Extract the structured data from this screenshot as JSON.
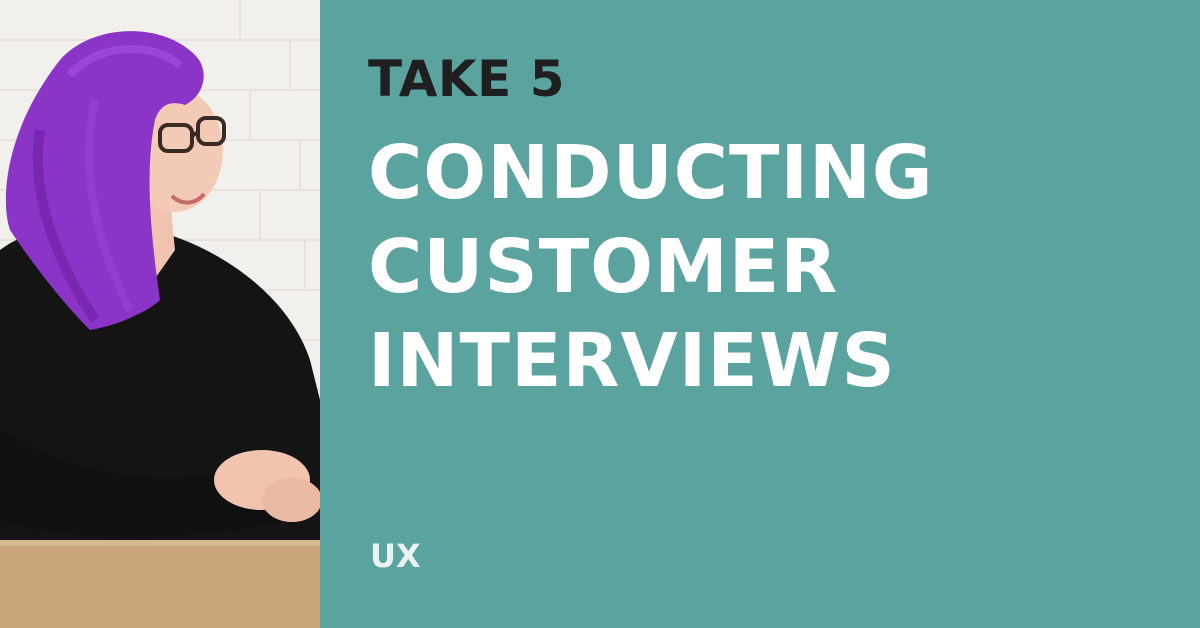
{
  "header": {
    "kicker": "TAKE 5"
  },
  "title": {
    "lines": [
      "CONDUCTING",
      "CUSTOMER",
      "INTERVIEWS"
    ]
  },
  "category": {
    "label": "UX"
  },
  "colors": {
    "panel_background": "#5ba39f",
    "kicker_text": "#1f1f1f",
    "title_text": "#ffffff",
    "category_text": "#e8f3f2"
  }
}
